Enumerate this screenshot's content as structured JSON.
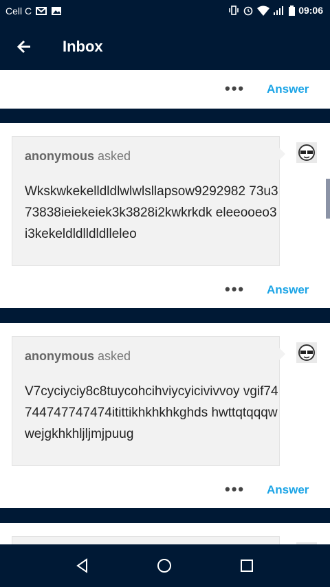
{
  "status_bar": {
    "carrier": "Cell C",
    "time": "09:06"
  },
  "header": {
    "title": "Inbox"
  },
  "actions": {
    "more_label": "•••",
    "answer_label": "Answer"
  },
  "questions": [
    {
      "asker": "anonymous",
      "asked_suffix": "asked",
      "text": "Wkskwkekelldldlwlwlsllapsow9292982 73u373838ieiekeiek3k3828i2kwkrkdk eleeooeo3i3kekeldldlldldlleleo"
    },
    {
      "asker": "anonymous",
      "asked_suffix": "asked",
      "text": "V7cyciyciy8c8tuycohcihviycyicivivvoy vgif74744747747474itittikhkhkhkghds hwttqtqqqwwejgkhkhljljmjpuug"
    }
  ],
  "icons": {
    "back": "arrow-left-icon",
    "avatar": "sunglasses-face-icon",
    "nav_back": "triangle-back-icon",
    "nav_home": "circle-home-icon",
    "nav_recent": "square-recents-icon"
  }
}
